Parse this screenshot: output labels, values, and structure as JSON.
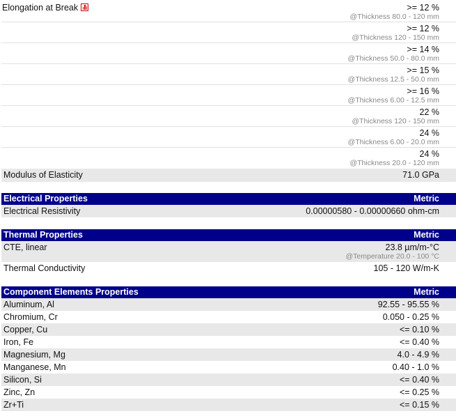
{
  "mechanical": {
    "elongation_label": "Elongation at Break",
    "elongation_rows": [
      {
        "value": ">= 12 %",
        "condition": "@Thickness 80.0 - 120 mm"
      },
      {
        "value": ">= 12 %",
        "condition": "@Thickness 120 - 150 mm"
      },
      {
        "value": ">= 14 %",
        "condition": "@Thickness 50.0 - 80.0 mm"
      },
      {
        "value": ">= 15 %",
        "condition": "@Thickness 12.5 - 50.0 mm"
      },
      {
        "value": ">= 16 %",
        "condition": "@Thickness 6.00 - 12.5 mm"
      },
      {
        "value": "22 %",
        "condition": "@Thickness 120 - 150 mm"
      },
      {
        "value": "24 %",
        "condition": "@Thickness 6.00 - 20.0 mm"
      },
      {
        "value": "24 %",
        "condition": "@Thickness 20.0 - 120 mm"
      }
    ],
    "modulus_label": "Modulus of Elasticity",
    "modulus_value": "71.0 GPa"
  },
  "electrical": {
    "header": "Electrical Properties",
    "metric": "Metric",
    "resistivity_label": "Electrical Resistivity",
    "resistivity_value": "0.00000580 - 0.00000660 ohm-cm"
  },
  "thermal": {
    "header": "Thermal Properties",
    "metric": "Metric",
    "cte_label": "CTE, linear",
    "cte_value": "23.8 µm/m-°C",
    "cte_condition": "@Temperature 20.0 - 100 °C",
    "conductivity_label": "Thermal Conductivity",
    "conductivity_value": "105 - 120 W/m-K"
  },
  "components": {
    "header": "Component Elements Properties",
    "metric": "Metric",
    "rows": [
      {
        "label": "Aluminum, Al",
        "value": "92.55 - 95.55 %"
      },
      {
        "label": "Chromium, Cr",
        "value": "0.050 - 0.25 %"
      },
      {
        "label": "Copper, Cu",
        "value": "<= 0.10 %"
      },
      {
        "label": "Iron, Fe",
        "value": "<= 0.40 %"
      },
      {
        "label": "Magnesium, Mg",
        "value": "4.0 - 4.9 %"
      },
      {
        "label": "Manganese, Mn",
        "value": "0.40 - 1.0 %"
      },
      {
        "label": "Silicon, Si",
        "value": "<= 0.40 %"
      },
      {
        "label": "Zinc, Zn",
        "value": "<= 0.25 %"
      },
      {
        "label": "Zr+Ti",
        "value": "<= 0.15 %"
      }
    ]
  },
  "icons": {
    "chart": "bar-chart-icon"
  },
  "colors": {
    "header_bg": "#00008b",
    "row_shade": "#e8e8e8",
    "condition_text": "#888888"
  }
}
